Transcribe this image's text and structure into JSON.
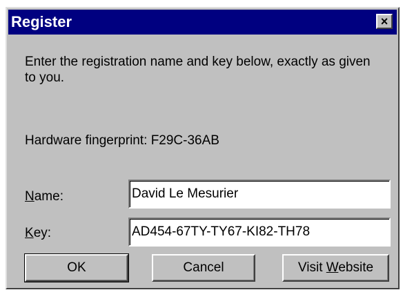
{
  "window": {
    "title": "Register",
    "close_glyph": "×"
  },
  "instructions": "Enter the registration name and key below, exactly as given to you.",
  "fingerprint": {
    "text": "Hardware fingerprint: F29C-36AB"
  },
  "form": {
    "name_label_accel": "N",
    "name_label_rest": "ame:",
    "name_value": "David Le Mesurier",
    "key_label_accel": "K",
    "key_label_rest": "ey:",
    "key_value": "AD454-67TY-TY67-KI82-TH78"
  },
  "buttons": {
    "ok_label": "OK",
    "cancel_label": "Cancel",
    "website_prefix": "Visit ",
    "website_accel": "W",
    "website_rest": "ebsite"
  }
}
